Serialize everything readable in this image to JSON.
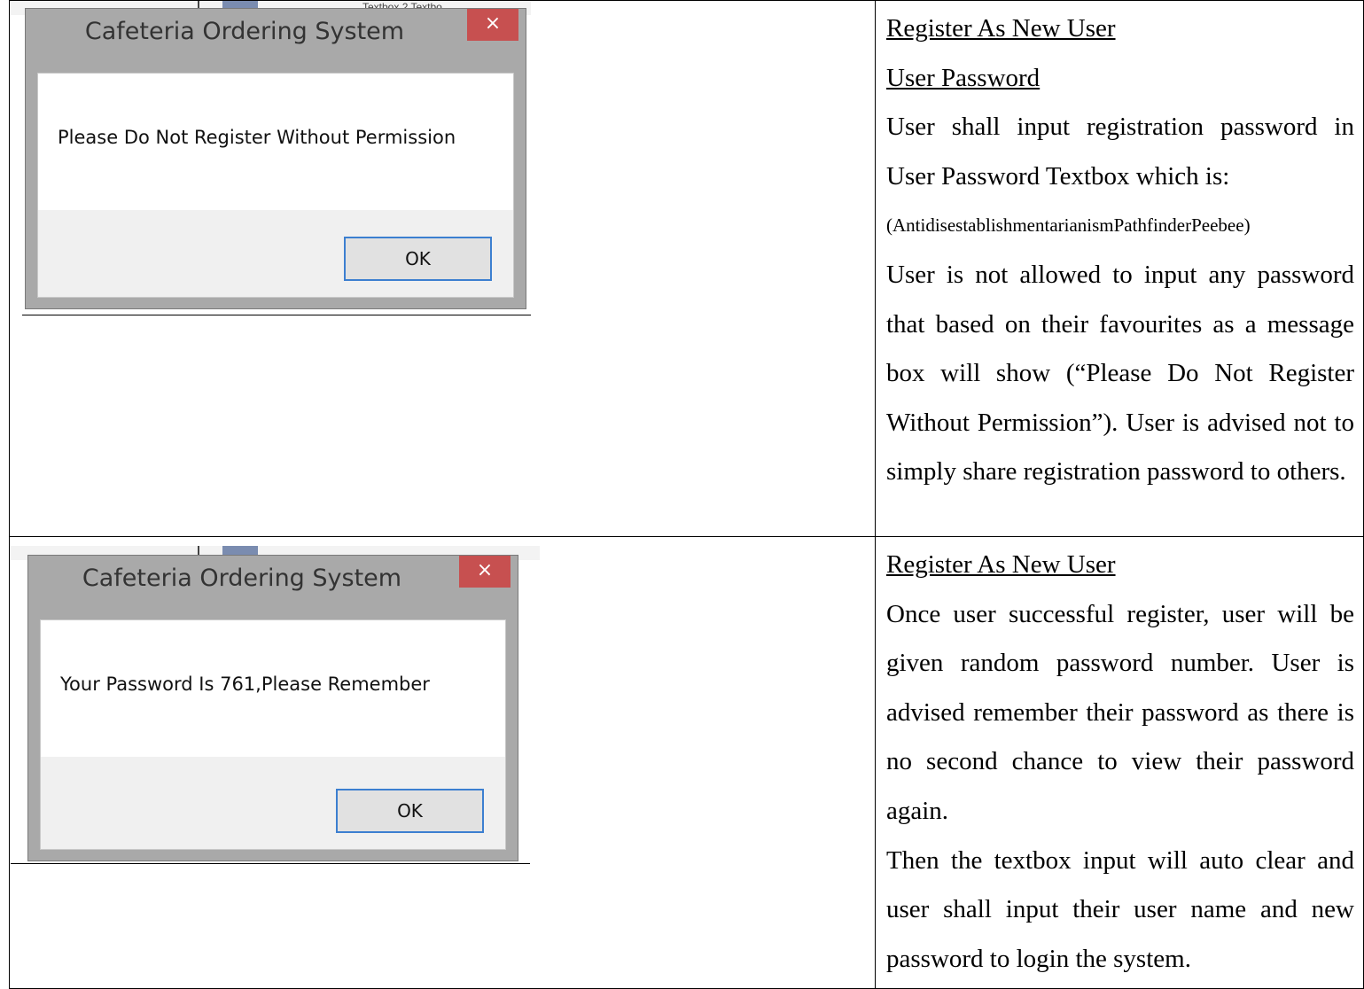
{
  "dialogs": [
    {
      "title": "Cafeteria Ordering System",
      "close_glyph": "×",
      "message": "Please Do Not Register Without Permission",
      "ok_label": "OK"
    },
    {
      "title": "Cafeteria Ordering System",
      "close_glyph": "×",
      "message": "Your Password Is 761,Please Remember",
      "ok_label": "OK"
    }
  ],
  "background_fragment": "Textbox 2  Textbo",
  "rows": [
    {
      "heading": "Register As New User",
      "subheading": "User Password",
      "line1": "User shall input registration password in User Password Textbox which is:",
      "password_example": "(AntidisestablishmentarianismPathfinderPeebee)",
      "line2": "User is not allowed to input any password that based on their favourites as a message box will show (“Please Do Not Register Without Permission”). User is advised not to simply share registration password to others."
    },
    {
      "heading": "Register As New User",
      "line1": "Once user successful register, user will be given random password number. User is advised remember their password as there is no second chance to view their password again.",
      "line2": "Then the textbox input will auto clear and user shall input their user name and new password to login the system."
    }
  ]
}
